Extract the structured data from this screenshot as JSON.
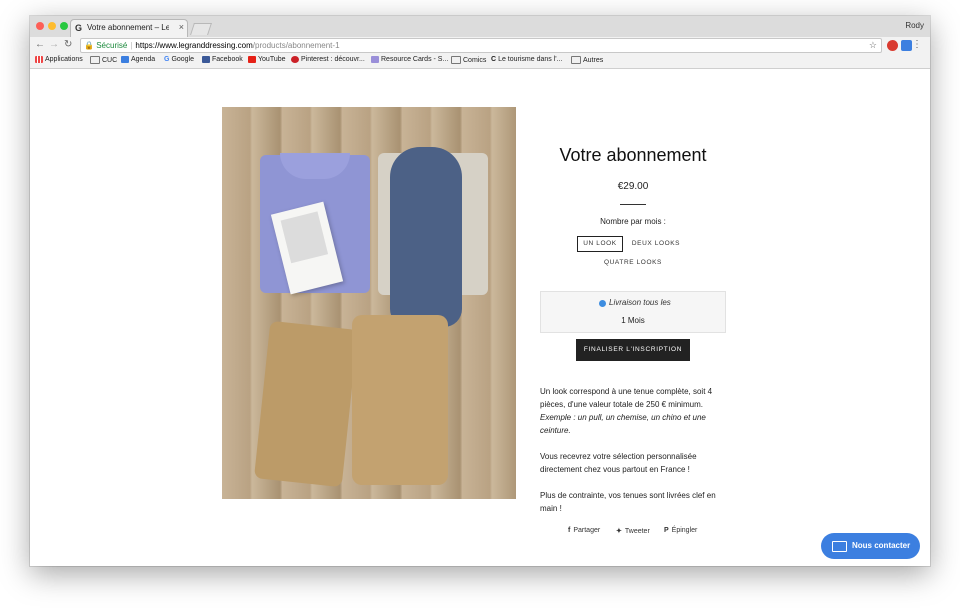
{
  "browser": {
    "tab_title": "Votre abonnement – Le Grand",
    "tab_favicon": "G",
    "tab_close": "×",
    "user_name": "Rody",
    "secure_label": "Sécurisé",
    "url_host": "https://www.legranddressing.com",
    "url_path": "/products/abonnement-1",
    "bookmarks": [
      {
        "label": "Applications"
      },
      {
        "label": "CUC"
      },
      {
        "label": "Agenda"
      },
      {
        "label": "Google"
      },
      {
        "label": "Facebook"
      },
      {
        "label": "YouTube"
      },
      {
        "label": "Pinterest : découvr..."
      },
      {
        "label": "Resource Cards - S..."
      },
      {
        "label": "Comics"
      },
      {
        "label": "Le tourisme dans l'..."
      },
      {
        "label": "Autres"
      }
    ]
  },
  "product": {
    "title": "Votre abonnement",
    "price": "€29.00",
    "option_label": "Nombre par mois :",
    "options": [
      {
        "label": "UN LOOK"
      },
      {
        "label": "DEUX LOOKS"
      },
      {
        "label": "QUATRE LOOKS"
      }
    ],
    "selected_option": "UN LOOK",
    "delivery_label": "Livraison tous les",
    "delivery_value": "1  Mois",
    "cta_label": "FINALISER L'INSCRIPTION",
    "desc_line1": "Un look correspond à une tenue complète, soit 4",
    "desc_line2": "pièces, d'une valeur totale de 250 € minimum.",
    "desc_line3": "Exemple : un pull, un chemise, un chino et une",
    "desc_line4": "ceinture.",
    "desc_line5": "Vous recevrez votre sélection personnalisée",
    "desc_line6": "directement chez vous partout en France !",
    "desc_line7": "Plus de contrainte, vos tenues sont livrées clef en",
    "desc_line8": "main !",
    "share": {
      "facebook": "Partager",
      "twitter": "Tweeter",
      "pinterest": "Épingler"
    }
  },
  "contact_button": "Nous contacter",
  "colors": {
    "contact_blue": "#3c7fe0",
    "cta_black": "#222222",
    "secure_green": "#1c8a3c"
  }
}
